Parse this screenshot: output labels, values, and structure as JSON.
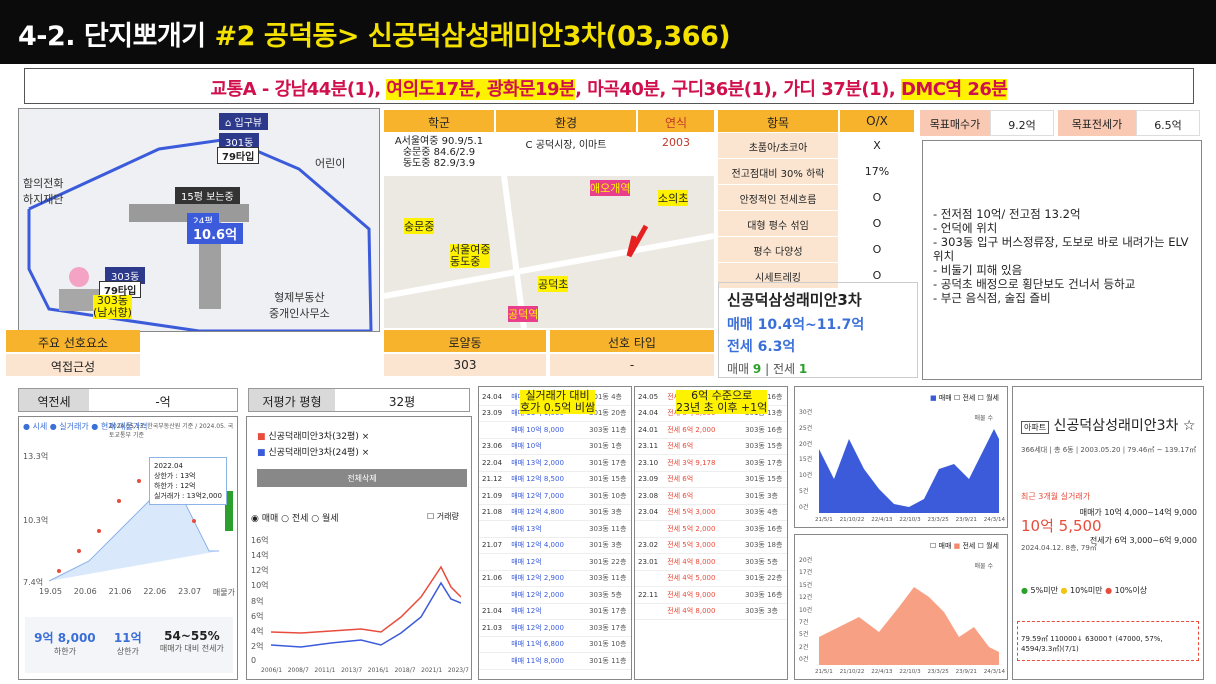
{
  "title": {
    "prefix": "4-2. 단지뽀개기 ",
    "highlight": "#2 공덕동> 신공덕삼성래미안3차(03,366)"
  },
  "traffic": {
    "a": "교통A - 강남44분(1), ",
    "b": "여의도17분, 광화문19분",
    "c": ", 마곡40분, 구디36분(1), 가디 37분(1), ",
    "d": "DMC역 26분"
  },
  "map": {
    "entrance": "입구뷰",
    "bldg301": "301동",
    "type79a": "79타입",
    "walk": "15평 보는중",
    "b24": "24평",
    "price24": "10.6억",
    "bldg303": "303동",
    "type79b": "79타입",
    "note303": "303동\n(남서향)",
    "area1": "어린이",
    "area2": "형제부동산\n중개인사무소",
    "area3": "함의전화\n하지재단"
  },
  "prefs": {
    "header": "주요 선호요소",
    "value": "역접근성"
  },
  "school_env": {
    "headers": [
      "학군",
      "환경",
      "연식"
    ],
    "school": "A서울여중 90.9/5.1\n숭문중 84.6/2.9\n동도중 82.9/3.9",
    "env": "C 공덕시장, 이마트",
    "year": "2003"
  },
  "mini_map": {
    "l1": "숭문중",
    "l2": "서울여중\n동도중",
    "l3": "공덕초",
    "l4": "소의초",
    "l5": "공덕역",
    "l6": "애오개역"
  },
  "royal": {
    "headers": [
      "로얄동",
      "선호 타입"
    ],
    "values": [
      "303",
      "-"
    ]
  },
  "checklist": {
    "headers": [
      "항목",
      "O/X"
    ],
    "rows": [
      [
        "초품아/초코아",
        "X"
      ],
      [
        "전고점대비 30% 하락",
        "17%"
      ],
      [
        "안정적인 전세흐름",
        "O"
      ],
      [
        "대형 평수 섞임",
        "O"
      ],
      [
        "평수 다양성",
        "O"
      ],
      [
        "시세트레킹",
        "O"
      ]
    ]
  },
  "target": {
    "buy_label": "목표매수가",
    "buy_value": "9.2억",
    "jeonse_label": "목표전세가",
    "jeonse_value": "6.5억"
  },
  "notes": [
    "전저점 10억/ 전고점 13.2억",
    "언덕에 위치",
    "303동 입구 버스정류장, 도보로 바로 내려가는 ELV 위치",
    "비둘기 피해 있음",
    "공덕초 배정으로 횡단보도 건너서 등하교",
    "부근 음식점, 술집 즐비"
  ],
  "price_card": {
    "name": "신공덕삼성래미안3차",
    "sale": "매매 10.4억~11.7억",
    "jeonse": "전세 6.3억",
    "count_sale_label": "매매",
    "count_sale": "9",
    "count_jeonse_label": "전세",
    "count_jeonse": "1"
  },
  "reverse": {
    "label": "역전세",
    "value": "-억"
  },
  "low_price": {
    "label": "저평가 평형",
    "value": "32평"
  },
  "left_chart": {
    "legend": "● 시세 ● 실거래가 ● 현재 매물가격",
    "date": "2024.05.13. 한국부동산원 기준 / 2024.05. 국토교통부 기준",
    "tooltip": [
      "2022.04",
      "상한가 : 13억",
      "하한가 : 12억",
      "실거래가 : 13억2,000"
    ],
    "xlabels": [
      "19.05",
      "20.06",
      "21.06",
      "22.06",
      "23.07",
      "매물가"
    ],
    "ylabels": [
      "13.3억",
      "10.3억",
      "7.4억"
    ],
    "stats": [
      {
        "v": "9억 8,000",
        "l": "하한가"
      },
      {
        "v": "11억",
        "l": "상한가"
      },
      {
        "v": "54~55%",
        "l": "매매가 대비 전세가"
      }
    ]
  },
  "compare": {
    "item1": "신공덕래미안3차(32평) ×",
    "item2": "신공덕래미안3차(24평) ×",
    "button": "전체삭제",
    "radio": [
      "매매",
      "전세",
      "월세"
    ],
    "check": "거래량",
    "ylabels": [
      "16억",
      "14억",
      "12억",
      "10억",
      "8억",
      "6억",
      "4억",
      "2억",
      "0"
    ],
    "xlabels": [
      "2006/1",
      "2008/7",
      "2011/1",
      "2013/7",
      "2016/1",
      "2018/7",
      "2021/1",
      "2023/7"
    ]
  },
  "trade_note1": "실거래가 대비\n호가 0.5억 비쌈",
  "trade_note2": "6억 수준으로\n23년 초 이후 +1억",
  "trades_left": [
    [
      "24.04",
      "매매 10억 5,000",
      "301동 4층"
    ],
    [
      "23.09",
      "매매 11억 1,000",
      "301동 20층"
    ],
    [
      "",
      "매매 10억 8,000",
      "303동 11층"
    ],
    [
      "23.06",
      "매매 10억",
      "301동 1층"
    ],
    [
      "22.04",
      "매매 13억 2,000",
      "301동 17층"
    ],
    [
      "21.12",
      "매매 12억 8,500",
      "301동 15층"
    ],
    [
      "21.09",
      "매매 12억 7,000",
      "301동 10층"
    ],
    [
      "21.08",
      "매매 12억 4,800",
      "301동 3층"
    ],
    [
      "",
      "매매 13억",
      "303동 11층"
    ],
    [
      "21.07",
      "매매 12억 4,000",
      "301동 3층"
    ],
    [
      "",
      "매매 12억",
      "301동 22층"
    ],
    [
      "21.06",
      "매매 12억 2,900",
      "303동 11층"
    ],
    [
      "",
      "매매 12억 2,000",
      "303동 5층"
    ],
    [
      "21.04",
      "매매 12억",
      "301동 17층"
    ],
    [
      "21.03",
      "매매 12억 2,000",
      "303동 17층"
    ],
    [
      "",
      "매매 11억 6,800",
      "301동 10층"
    ],
    [
      "",
      "매매 11억 8,000",
      "301동 11층"
    ]
  ],
  "trades_right": [
    [
      "24.05",
      "전세 5억 5,000",
      "303동 16층"
    ],
    [
      "24.04",
      "전세 6억 8,000",
      "301동 13층"
    ],
    [
      "24.01",
      "전세 6억 2,000",
      "303동 16층"
    ],
    [
      "23.11",
      "전세 6억",
      "303동 15층"
    ],
    [
      "23.10",
      "전세 3억 9,178",
      "303동 17층"
    ],
    [
      "23.09",
      "전세 6억",
      "301동 15층"
    ],
    [
      "23.08",
      "전세 6억",
      "301동 3층"
    ],
    [
      "23.04",
      "전세 5억 3,000",
      "303동 4층"
    ],
    [
      "",
      "전세 5억 2,000",
      "303동 16층"
    ],
    [
      "23.02",
      "전세 5억 3,000",
      "303동 18층"
    ],
    [
      "23.01",
      "전세 4억 8,000",
      "303동 5층"
    ],
    [
      "",
      "전세 4억 5,000",
      "301동 22층"
    ],
    [
      "22.11",
      "전세 4억 9,000",
      "303동 16층"
    ],
    [
      "",
      "전세 4억 8,000",
      "303동 3층"
    ]
  ],
  "vol_charts": {
    "legend": [
      "매매",
      "전세",
      "월세"
    ],
    "top_y": [
      "30건",
      "25건",
      "20건",
      "15건",
      "10건",
      "5건",
      "0건"
    ],
    "bottom_y": [
      "20건",
      "17건",
      "15건",
      "12건",
      "10건",
      "7건",
      "5건",
      "2건",
      "0건"
    ],
    "x": [
      "21/5/1",
      "21/10/22",
      "22/4/13",
      "22/10/3",
      "23/3/25",
      "23/9/21",
      "24/3/14"
    ],
    "note": "매물 수"
  },
  "summary_card": {
    "badge": "아파트",
    "name": "신공덕삼성래미안3차",
    "info": "366세대 | 총 6동 | 2003.05.20 | 79.46㎡ ~ 139.17㎡",
    "recent_label": "최근 3개월 실거래가",
    "recent_value": "10억 5,500",
    "recent_date": "2024.04.12. 8층, 79㎡",
    "sale_range": "매매가 10억 4,000~14억 9,000",
    "jeonse_range": "전세가 6억 3,000~6억 9,000",
    "legend": [
      "5%미만",
      "10%미만",
      "10%이상"
    ],
    "bottom": "79.59㎡  110000↓  63000↑  (47000, 57%, 4594/3.3㎡)(7/1)"
  }
}
